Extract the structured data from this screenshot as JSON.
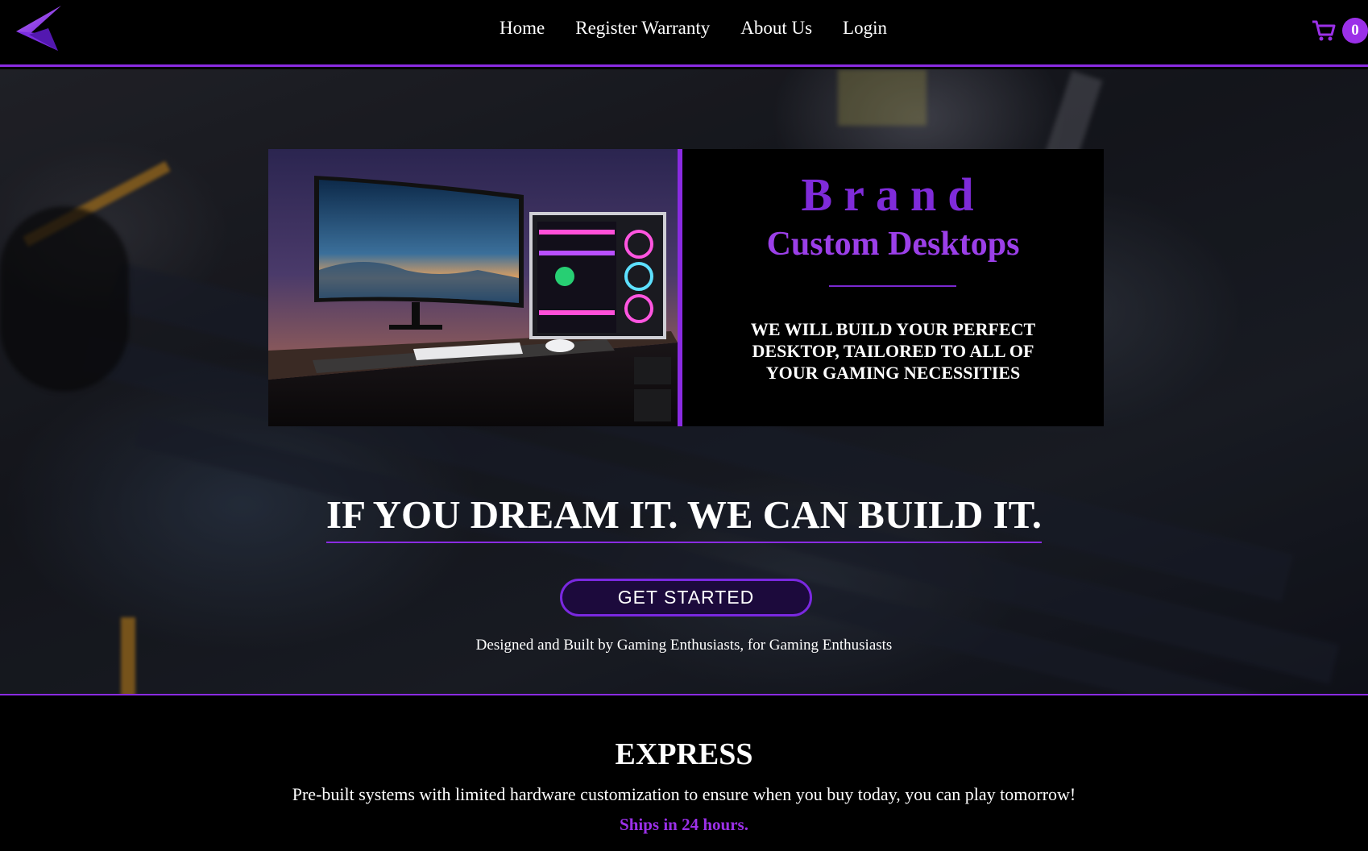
{
  "nav": {
    "logo_icon": "brand-logo-icon",
    "links": [
      "Home",
      "Register Warranty",
      "About Us",
      "Login"
    ],
    "cart_icon": "shopping-cart-icon",
    "cart_count": "0"
  },
  "hero": {
    "brand_title": "Brand",
    "brand_subtitle": "Custom Desktops",
    "tagline": "WE WILL BUILD YOUR PERFECT DESKTOP, TAILORED TO ALL OF YOUR GAMING NECESSITIES",
    "headline": "IF YOU DREAM IT. WE CAN BUILD IT.",
    "cta_label": "GET STARTED",
    "caption": "Designed and Built by Gaming Enthusiasts, for Gaming Enthusiasts"
  },
  "express": {
    "title": "EXPRESS",
    "description": "Pre-built systems with limited hardware customization to ensure when you buy today, you can play tomorrow!",
    "ship_note": "Ships in 24 hours."
  },
  "colors": {
    "accent": "#8a2be2",
    "brand_purple": "#7f2bd9",
    "background": "#000000"
  }
}
